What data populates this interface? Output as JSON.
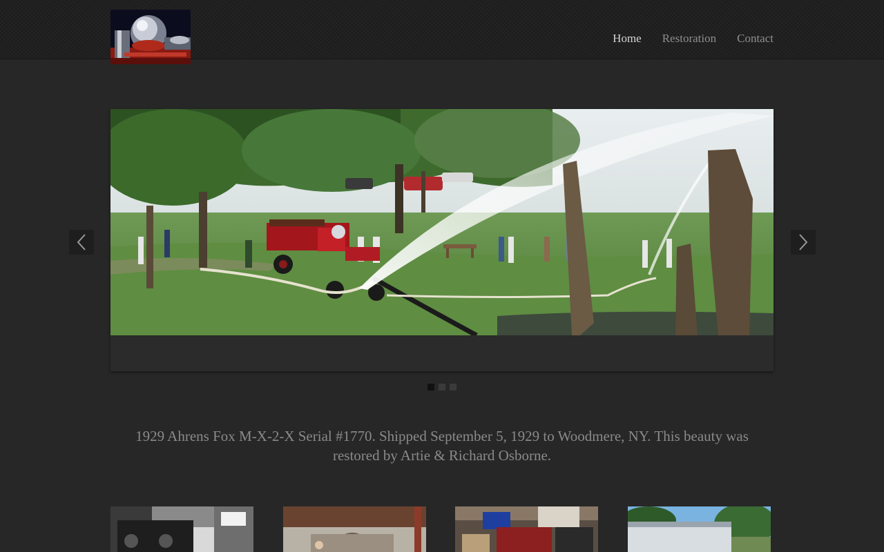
{
  "nav": {
    "items": [
      {
        "label": "Home",
        "active": true
      },
      {
        "label": "Restoration",
        "active": false
      },
      {
        "label": "Contact",
        "active": false
      }
    ]
  },
  "slider": {
    "slide_count": 3,
    "active_index": 0,
    "prev_icon": "chevron-left-icon",
    "next_icon": "chevron-right-icon"
  },
  "caption": "1929 Ahrens Fox M-X-2-X Serial #1770. Shipped September 5, 1929 to Woodmere, NY. This beauty was restored by Artie & Richard Osborne.",
  "colors": {
    "background": "#272727",
    "header": "#1c1c1c",
    "nav_active": "#d4d4d4",
    "nav_inactive": "#8e8e8e",
    "text": "#8a8a8a"
  }
}
